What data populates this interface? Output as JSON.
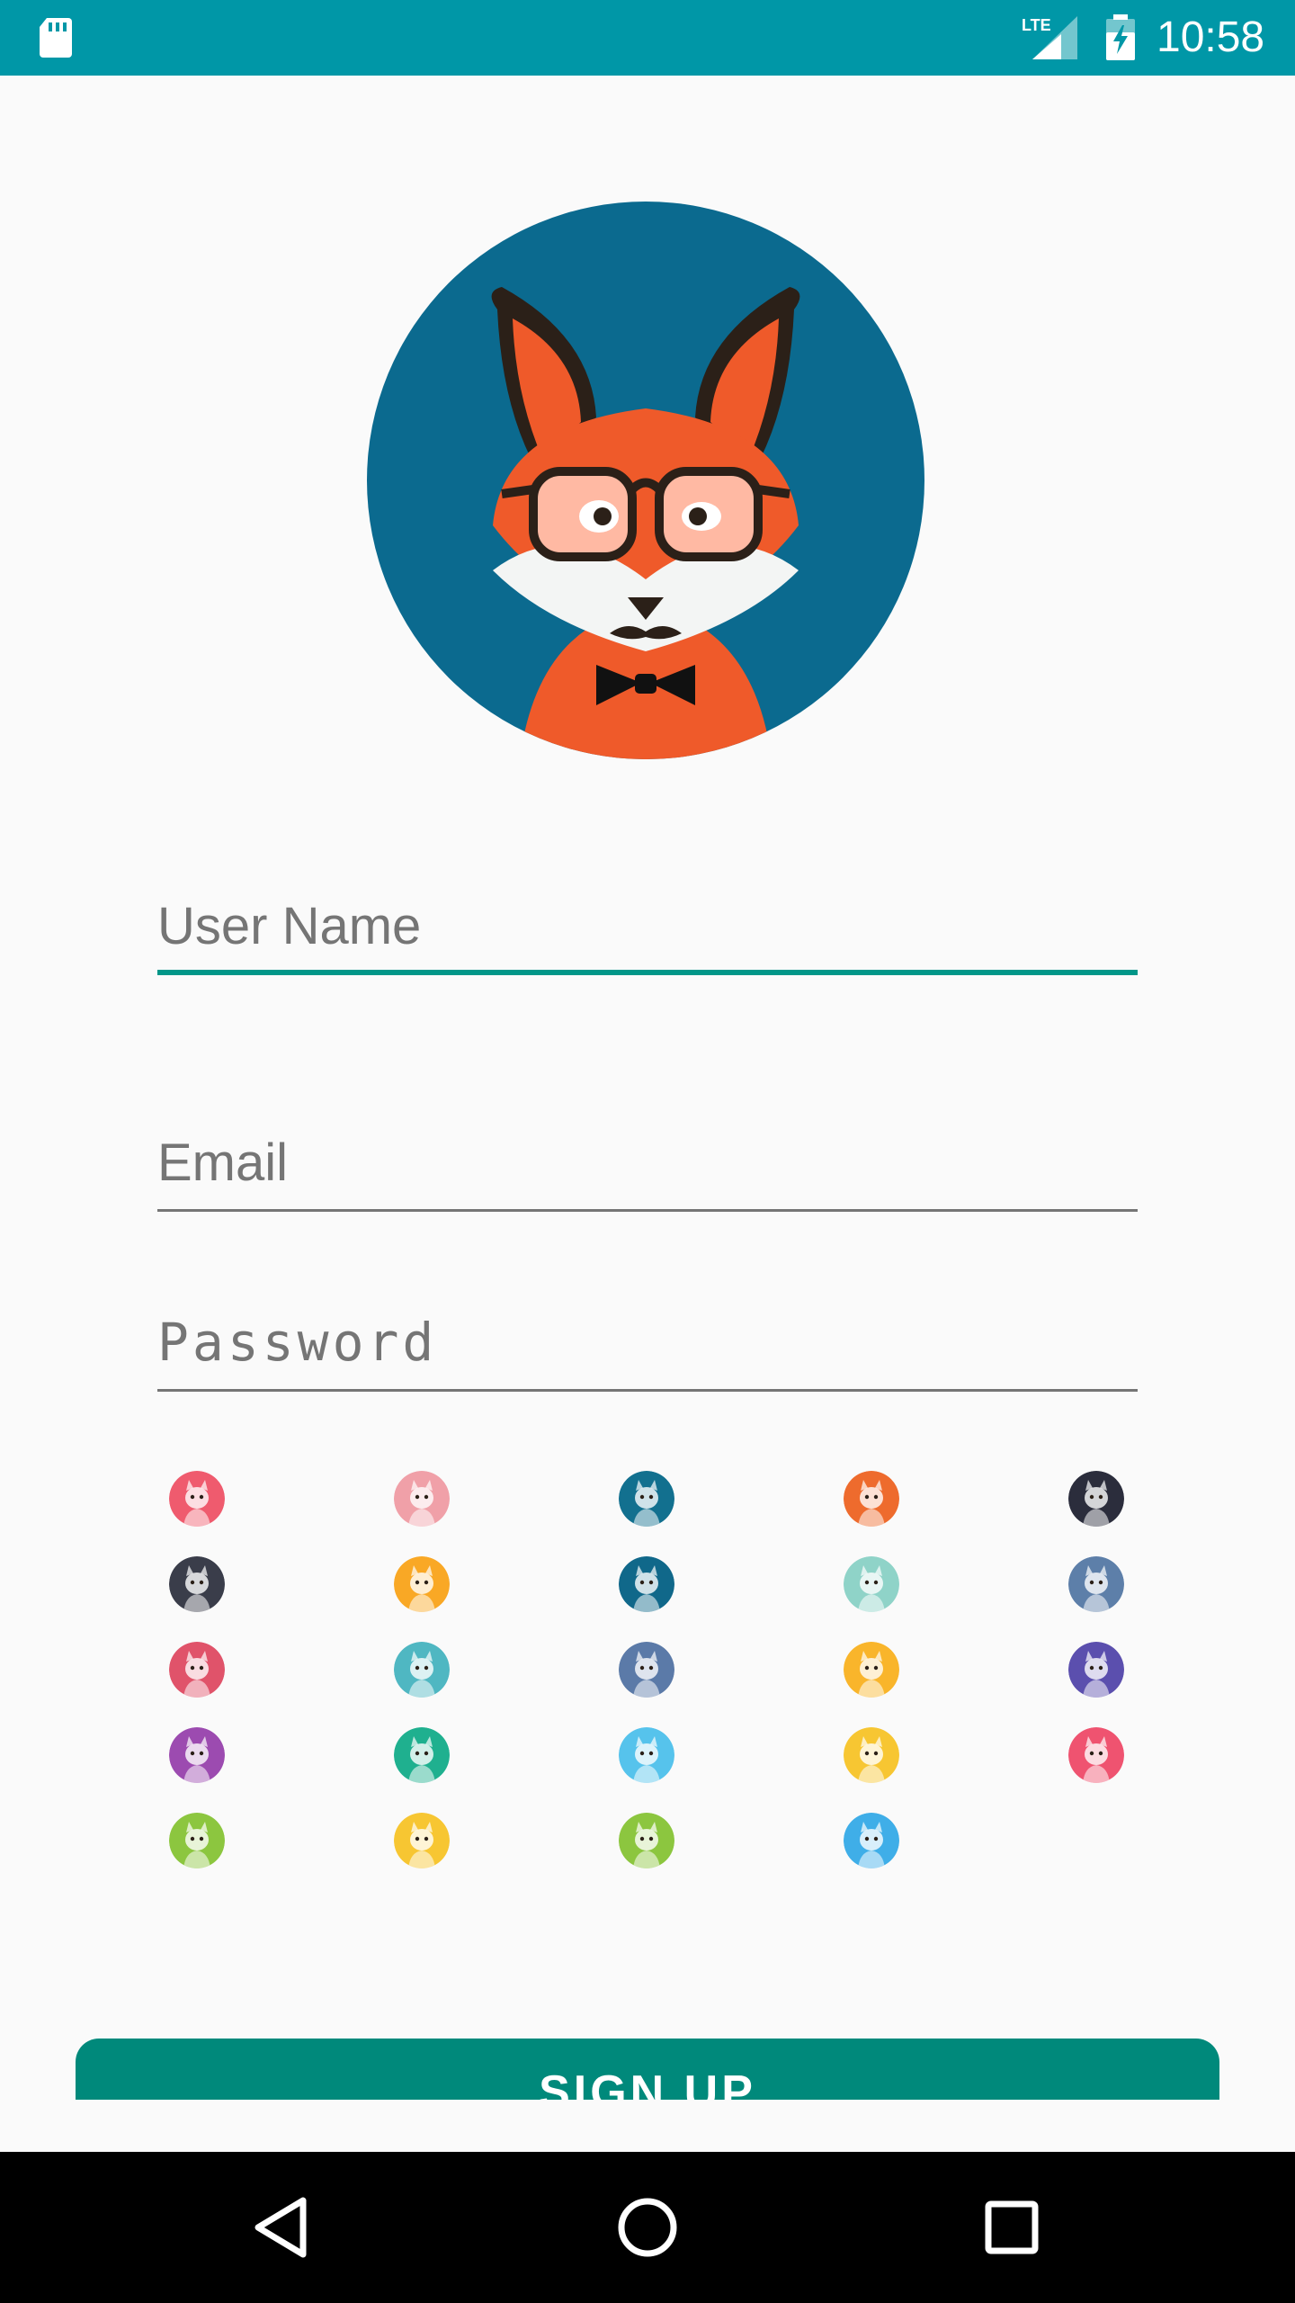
{
  "status_bar": {
    "time": "10:58",
    "network_label": "LTE",
    "sd_icon": "sd-card-icon",
    "battery_icon": "battery-charging-icon",
    "background_color": "#0097a7"
  },
  "profile_avatar": {
    "icon": "fox-with-glasses-avatar",
    "background_color": "#0b6a8f"
  },
  "form": {
    "username": {
      "placeholder": "User Name",
      "value": ""
    },
    "email": {
      "placeholder": "Email",
      "value": ""
    },
    "password": {
      "placeholder": "Password",
      "value": ""
    },
    "accent_color": "#009688"
  },
  "avatar_options": [
    {
      "name": "rabbit",
      "bg": "#ef5b6e"
    },
    {
      "name": "bear",
      "bg": "#f0a0a8"
    },
    {
      "name": "fox",
      "bg": "#12708f"
    },
    {
      "name": "cat",
      "bg": "#ee6b2d"
    },
    {
      "name": "ninja",
      "bg": "#2b2d3c"
    },
    {
      "name": "robot",
      "bg": "#3a3d4a"
    },
    {
      "name": "dog",
      "bg": "#f9a825"
    },
    {
      "name": "fox-glasses",
      "bg": "#10688a"
    },
    {
      "name": "deer",
      "bg": "#8fd3c8"
    },
    {
      "name": "tiger",
      "bg": "#5d7fa9"
    },
    {
      "name": "owl",
      "bg": "#e0536a"
    },
    {
      "name": "monkey",
      "bg": "#4fb7c2"
    },
    {
      "name": "rooster",
      "bg": "#5b7aa8"
    },
    {
      "name": "panda",
      "bg": "#f9b52b"
    },
    {
      "name": "monster",
      "bg": "#5b4fae"
    },
    {
      "name": "frog",
      "bg": "#9c4bb0"
    },
    {
      "name": "chick",
      "bg": "#1fb08f"
    },
    {
      "name": "schnauzer",
      "bg": "#56c3ec"
    },
    {
      "name": "hamster",
      "bg": "#f7c632"
    },
    {
      "name": "gorilla",
      "bg": "#ef5370"
    },
    {
      "name": "lion",
      "bg": "#8cc63f"
    },
    {
      "name": "koala",
      "bg": "#f7c632"
    },
    {
      "name": "fox-green",
      "bg": "#8cc63f"
    },
    {
      "name": "tiger-blue",
      "bg": "#3faee8"
    }
  ],
  "signup_button": {
    "label": "SIGN UP",
    "color": "#00897b"
  },
  "nav_bar": {
    "back_icon": "back-triangle-icon",
    "home_icon": "home-circle-icon",
    "recents_icon": "recents-square-icon"
  }
}
